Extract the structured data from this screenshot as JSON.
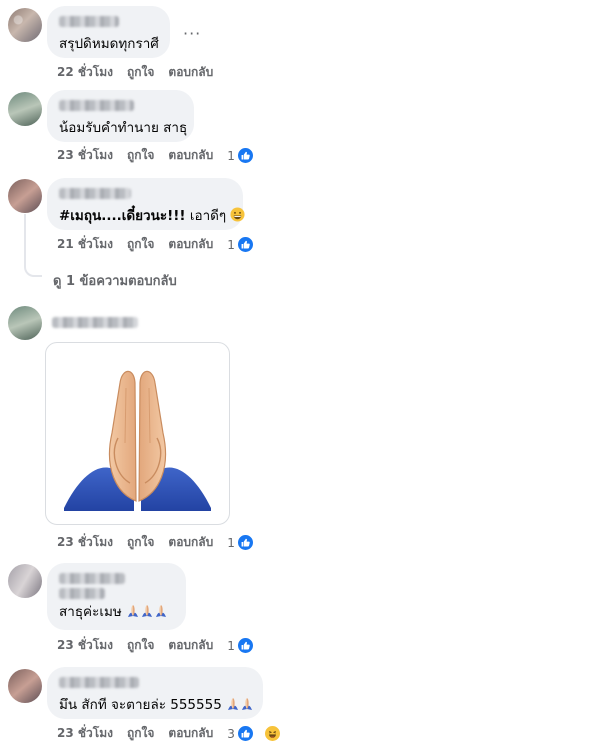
{
  "comments": [
    {
      "text": "สรุปดิหมดทุกราศี",
      "time": "22 ชั่วโมง",
      "like": "ถูกใจ",
      "reply": "ตอบกลับ",
      "more": "···"
    },
    {
      "text": "น้อมรับคำทำนาย สาธุ",
      "time": "23 ชั่วโมง",
      "like": "ถูกใจ",
      "reply": "ตอบกลับ",
      "reaction_count": "1"
    },
    {
      "text_bold": "#เมถุน....เดี๋ยวนะ!!!",
      "text_rest": " เอาดีๆ",
      "time": "21 ชั่วโมง",
      "like": "ถูกใจ",
      "reply": "ตอบกลับ",
      "reaction_count": "1",
      "view_replies": "ดู 1 ข้อความตอบกลับ"
    },
    {
      "sticker": "folded-hands",
      "time": "23 ชั่วโมง",
      "like": "ถูกใจ",
      "reply": "ตอบกลับ",
      "reaction_count": "1"
    },
    {
      "text": "สาธุค่ะเมษ",
      "time": "23 ชั่วโมง",
      "like": "ถูกใจ",
      "reply": "ตอบกลับ",
      "reaction_count": "1"
    },
    {
      "text": "มึน สักที จะตายล่ะ 555555",
      "time": "23 ชั่วโมง",
      "like": "ถูกใจ",
      "reply": "ตอบกลับ",
      "reaction_count": "3"
    }
  ],
  "colors": {
    "bubble": "#f0f2f5",
    "meta": "#65676b",
    "like_blue": "#1877f2",
    "haha_yellow": "#f7c33b"
  },
  "icons": [
    "like-icon",
    "haha-icon",
    "grin-emoji",
    "folded-hands-emoji",
    "more-icon"
  ]
}
